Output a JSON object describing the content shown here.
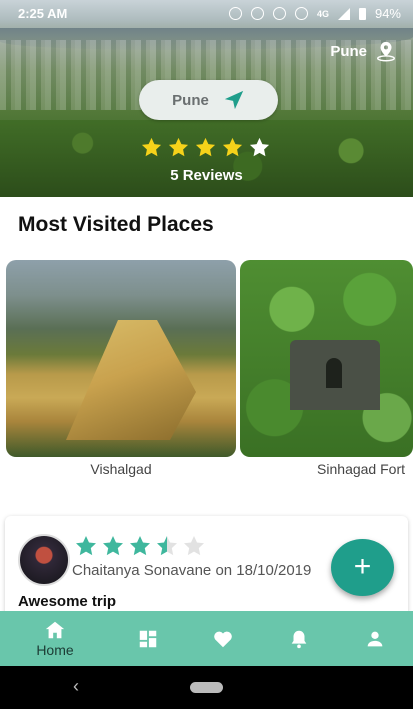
{
  "status_bar": {
    "time": "2:25 AM",
    "battery": "94%",
    "network": "4G"
  },
  "header": {
    "location_label": "Pune"
  },
  "city_pill": {
    "name": "Pune"
  },
  "hero": {
    "rating": 4,
    "max_rating": 5,
    "reviews_text": "5 Reviews"
  },
  "section": {
    "title": "Most Visited Places"
  },
  "places": [
    {
      "name": "Vishalgad"
    },
    {
      "name": "Sinhagad Fort"
    }
  ],
  "review": {
    "rating": 3.5,
    "max_rating": 5,
    "author_line": "Chaitanya Sonavane on 18/10/2019",
    "title": "Awesome trip"
  },
  "fab": {
    "label": "+"
  },
  "bottom_nav": {
    "home_label": "Home",
    "items": [
      "home-icon",
      "dashboard-icon",
      "favorites-icon",
      "notifications-icon",
      "profile-icon"
    ]
  },
  "colors": {
    "accent": "#1f9e8b",
    "nav_bg": "#69c6ab",
    "star_gold": "#f5d21a",
    "star_teal": "#3fb79d"
  }
}
